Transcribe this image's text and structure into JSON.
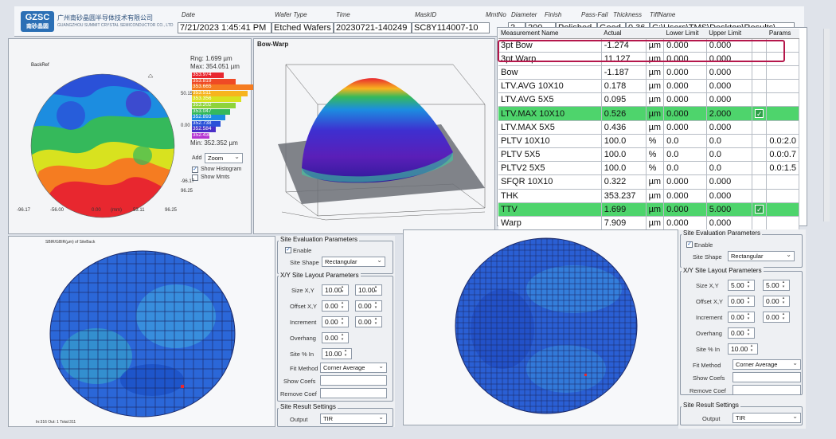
{
  "header": {
    "logo_badge": "GZSC",
    "logo_badge_sub": "南砂晶圆",
    "logo_text": "广州南砂晶圆半导体技术有限公司",
    "logo_sub": "GUANGZHOU SUMMIT CRYSTAL SEMICONDUCTOR CO., LTD",
    "fields": [
      {
        "label": "Date",
        "value": "7/21/2023 1:45:41 PM"
      },
      {
        "label": "Wafer Type",
        "value": "Etched Wafers"
      },
      {
        "label": "Time",
        "value": "20230721-140249"
      },
      {
        "label": "MaskID",
        "value": "SC8Y114007-10"
      },
      {
        "label": "MmtNo",
        "value": "2"
      },
      {
        "label": "Diameter",
        "value": "200"
      },
      {
        "label": "Finish",
        "value": "Polished"
      },
      {
        "label": "Pass-Fail",
        "value": "Good"
      },
      {
        "label": "Thickness",
        "value": "0.36"
      },
      {
        "label": "TiffName",
        "value": "C:\\Users\\TMS\\Desktop\\Results\\"
      }
    ]
  },
  "backref": {
    "title": "BackRef",
    "rng": "Rng: 1.699 µm",
    "max": "Max: 354.051 µm",
    "min": "Min: 352.352 µm",
    "legend": [
      "353.974",
      "353.819",
      "353.665",
      "353.511",
      "353.356",
      "353.202",
      "353.047",
      "352.893",
      "352.738",
      "352.584",
      "352.430"
    ],
    "legend_colors": [
      "#e8272f",
      "#ef4a25",
      "#f57c21",
      "#f7b41e",
      "#d8e21f",
      "#8ed33a",
      "#35b95b",
      "#1c8de0",
      "#2a51d8",
      "#4a2fc8",
      "#b534d2"
    ],
    "add_label": "Add",
    "add_value": "Zoom",
    "show_histogram": "Show Histogram",
    "show_mmts": "Show Mmts",
    "show_histogram_checked": true,
    "show_mmts_checked": false,
    "yticks": [
      "0.00",
      "50.15",
      "0.00",
      "-96.17",
      "96.25"
    ],
    "xticks": [
      "-96.17",
      "-56.00",
      "0.00",
      "(mm)",
      "53.11",
      "96.25"
    ]
  },
  "bowwarp": {
    "title": "Bow-Warp"
  },
  "table": {
    "headers": [
      "Measurement Name",
      "Actual",
      "",
      "Lower Limit",
      "Upper Limit",
      "",
      "Params"
    ],
    "rows": [
      {
        "name": "3pt Bow",
        "actual": "-1.274",
        "unit": "µm",
        "lower": "0.000",
        "upper": "0.000",
        "check": "",
        "params": "",
        "pass": false
      },
      {
        "name": "3pt Warp",
        "actual": "11.127",
        "unit": "µm",
        "lower": "0.000",
        "upper": "0.000",
        "check": "",
        "params": "",
        "pass": false
      },
      {
        "name": "Bow",
        "actual": "-1.187",
        "unit": "µm",
        "lower": "0.000",
        "upper": "0.000",
        "check": "",
        "params": "",
        "pass": false
      },
      {
        "name": "LTV.AVG 10X10",
        "actual": "0.178",
        "unit": "µm",
        "lower": "0.000",
        "upper": "0.000",
        "check": "",
        "params": "",
        "pass": false
      },
      {
        "name": "LTV.AVG 5X5",
        "actual": "0.095",
        "unit": "µm",
        "lower": "0.000",
        "upper": "0.000",
        "check": "",
        "params": "",
        "pass": false
      },
      {
        "name": "LTV.MAX 10X10",
        "actual": "0.526",
        "unit": "µm",
        "lower": "0.000",
        "upper": "2.000",
        "check": "✓",
        "params": "",
        "pass": true
      },
      {
        "name": "LTV.MAX 5X5",
        "actual": "0.436",
        "unit": "µm",
        "lower": "0.000",
        "upper": "0.000",
        "check": "",
        "params": "",
        "pass": false
      },
      {
        "name": "PLTV 10X10",
        "actual": "100.0",
        "unit": "%",
        "lower": "0.0",
        "upper": "0.0",
        "check": "",
        "params": "0.0:2.0",
        "pass": false
      },
      {
        "name": "PLTV 5X5",
        "actual": "100.0",
        "unit": "%",
        "lower": "0.0",
        "upper": "0.0",
        "check": "",
        "params": "0.0:0.7",
        "pass": false
      },
      {
        "name": "PLTV2 5X5",
        "actual": "100.0",
        "unit": "%",
        "lower": "0.0",
        "upper": "0.0",
        "check": "",
        "params": "0.0:1.5",
        "pass": false
      },
      {
        "name": "SFQR 10X10",
        "actual": "0.322",
        "unit": "µm",
        "lower": "0.000",
        "upper": "0.000",
        "check": "",
        "params": "",
        "pass": false
      },
      {
        "name": "THK",
        "actual": "353.237",
        "unit": "µm",
        "lower": "0.000",
        "upper": "0.000",
        "check": "",
        "params": "",
        "pass": false
      },
      {
        "name": "TTV",
        "actual": "1.699",
        "unit": "µm",
        "lower": "0.000",
        "upper": "5.000",
        "check": "✓",
        "params": "",
        "pass": true
      },
      {
        "name": "Warp",
        "actual": "7.909",
        "unit": "µm",
        "lower": "0.000",
        "upper": "0.000",
        "check": "",
        "params": "",
        "pass": false
      }
    ]
  },
  "site_left": {
    "map_title": "SBIR/GBIR(µm) of SiteBack",
    "map_footer": "In:316 Out: 1 Total:311",
    "eval_title": "Site Evaluation Parameters",
    "enable": "Enable",
    "enable_checked": true,
    "site_shape_label": "Site Shape",
    "site_shape": "Rectangular",
    "layout_title": "X/Y Site Layout Parameters",
    "size_label": "Size X,Y",
    "size_x": "10.00",
    "size_y": "10.00",
    "offset_label": "Offset X,Y",
    "offset_x": "0.00",
    "offset_y": "0.00",
    "increment_label": "Increment",
    "inc_x": "0.00",
    "inc_y": "0.00",
    "overhang_label": "Overhang",
    "overhang": "0.00",
    "sitepct_label": "Site % In",
    "sitepct": "10.00",
    "fit_label": "Fit Method",
    "fit": "Corner Average",
    "coefs_label": "Show Coefs",
    "remove_label": "Remove Coef",
    "result_title": "Site Result Settings",
    "output_label": "Output",
    "output": "TIR"
  },
  "site_right": {
    "eval_title": "Site Evaluation Parameters",
    "enable": "Enable",
    "enable_checked": true,
    "site_shape_label": "Site Shape",
    "site_shape": "Rectangular",
    "layout_title": "X/Y Site Layout Parameters",
    "size_label": "Size X,Y",
    "size_x": "5.00",
    "size_y": "5.00",
    "offset_label": "Offset X,Y",
    "offset_x": "0.00",
    "offset_y": "0.00",
    "increment_label": "Increment",
    "inc_x": "0.00",
    "inc_y": "0.00",
    "overhang_label": "Overhang",
    "overhang": "0.00",
    "sitepct_label": "Site % In",
    "sitepct": "10.00",
    "fit_label": "Fit Method",
    "fit": "Corner Average",
    "coefs_label": "Show Coefs",
    "remove_label": "Remove Coef",
    "result_title": "Site Result Settings",
    "output_label": "Output",
    "output": "TIR"
  }
}
